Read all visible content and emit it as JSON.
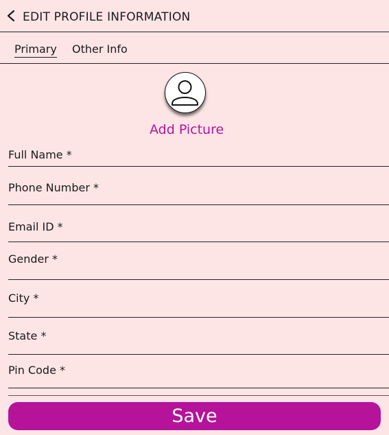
{
  "header": {
    "title": "EDIT PROFILE INFORMATION",
    "back_icon": "chevron-left-icon"
  },
  "tabs": [
    {
      "label": "Primary",
      "active": true
    },
    {
      "label": "Other Info",
      "active": false
    }
  ],
  "profile_picture": {
    "icon": "user-icon",
    "add_label": "Add Picture"
  },
  "form": {
    "fields": [
      {
        "label": "Full Name *",
        "value": ""
      },
      {
        "label": "Phone Number *",
        "value": ""
      },
      {
        "label": "Email ID *",
        "value": ""
      },
      {
        "label": "Gender *",
        "value": ""
      },
      {
        "label": "City *",
        "value": ""
      },
      {
        "label": "State *",
        "value": ""
      },
      {
        "label": "Pin Code *",
        "value": ""
      }
    ]
  },
  "actions": {
    "save_label": "Save"
  },
  "colors": {
    "background": "#fde5e6",
    "accent": "#b5139a",
    "text": "#1a1a1a"
  }
}
